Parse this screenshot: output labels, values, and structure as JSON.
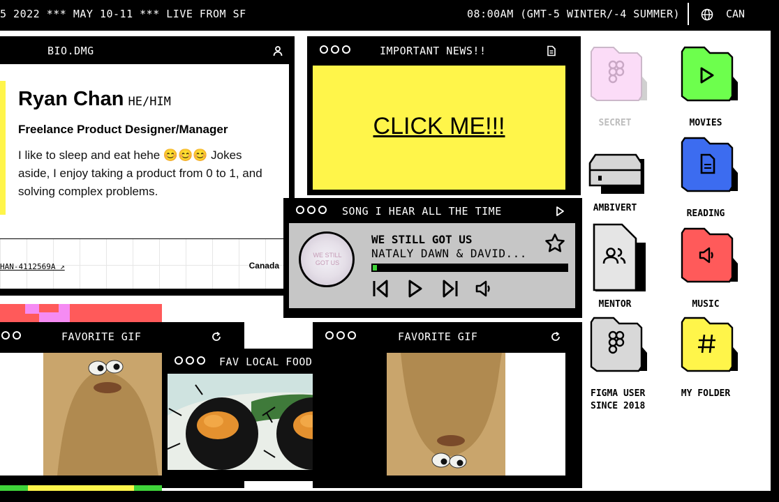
{
  "top_bar": {
    "ticker": "5 2022 *** MAY 10-11 *** LIVE FROM SF",
    "clock": "08:00AM (GMT-5 WINTER/-4 SUMMER)",
    "country": "CAN",
    "icons": [
      "globe-icon"
    ]
  },
  "colors": {
    "yellow": "#fff54a",
    "pink": "#f58bf3",
    "red": "#ff5a5a",
    "green": "#3fd43a",
    "blue": "#3c6cf0",
    "gray": "#c6c6c6"
  },
  "bio": {
    "title": "BIO.DMG",
    "icon": "person-icon",
    "name": "Ryan Chan",
    "pronouns": "HE/HIM",
    "role": "Freelance Product Designer/Manager",
    "description": "I like to sleep and eat hehe 😊😊😊 Jokes aside, I enjoy taking a product from 0 to 1, and solving complex problems.",
    "link": "HAN-4112569A ↗",
    "location": "Canada"
  },
  "news": {
    "title": "IMPORTANT NEWS!!",
    "icon": "document-icon",
    "cta": "CLICK ME!!!"
  },
  "song": {
    "window_title": "SONG I HEAR ALL THE TIME",
    "title": "WE STILL GOT US",
    "artist": "NATALY DAWN & DAVID...",
    "art_text": "WE STILL GOT US",
    "progress": 0.02,
    "icons": [
      "play-icon",
      "star-icon",
      "skip-back-icon",
      "play-icon",
      "skip-forward-icon",
      "volume-icon"
    ]
  },
  "gif_left": {
    "title": "FAVORITE GIF",
    "icon": "refresh-icon"
  },
  "food": {
    "title": "FAV LOCAL FOOD",
    "icon": "image-icon"
  },
  "gif_right": {
    "title": "FAVORITE GIF",
    "icon": "refresh-icon"
  },
  "desktop_icons": [
    {
      "label": "SECRET",
      "icon": "figma-folder-icon"
    },
    {
      "label": "MOVIES",
      "icon": "play-folder-icon"
    },
    {
      "label": "AMBIVERT",
      "icon": "drive-icon"
    },
    {
      "label": "READING",
      "icon": "document-folder-icon"
    },
    {
      "label": "MENTOR",
      "icon": "people-file-icon"
    },
    {
      "label": "MUSIC",
      "icon": "music-folder-icon"
    },
    {
      "label": "FIGMA USER SINCE 2018",
      "icon": "figma-folder-icon"
    },
    {
      "label": "MY FOLDER",
      "icon": "hash-folder-icon"
    }
  ]
}
